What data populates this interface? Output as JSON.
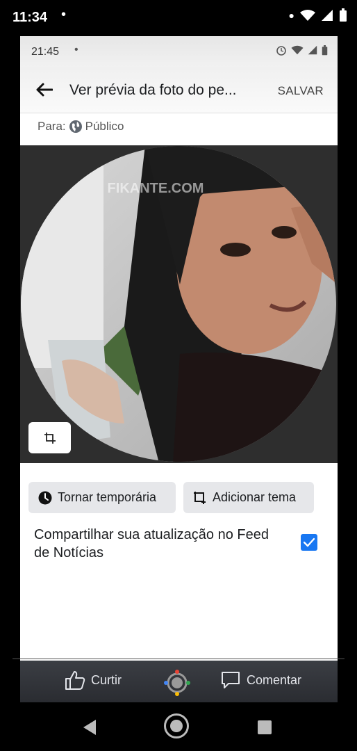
{
  "outer_status": {
    "time": "11:34",
    "dot": "•"
  },
  "inner_status": {
    "time": "21:45",
    "dot": "•"
  },
  "appbar": {
    "title": "Ver prévia da foto do pe...",
    "save_label": "SALVAR"
  },
  "audience": {
    "prefix": "Para:",
    "value": "Público"
  },
  "photo": {
    "watermark": "FIKANTE.COM"
  },
  "chips": {
    "temporary_label": "Tornar temporária",
    "theme_label": "Adicionar tema"
  },
  "share": {
    "text": "Compartilhar sua atualização no Feed de Notícias",
    "checked": true
  },
  "bottom_bar": {
    "like_label": "Curtir",
    "comment_label": "Comentar"
  },
  "colors": {
    "accent": "#1877f2",
    "bottom_bar": "#2f3237"
  }
}
